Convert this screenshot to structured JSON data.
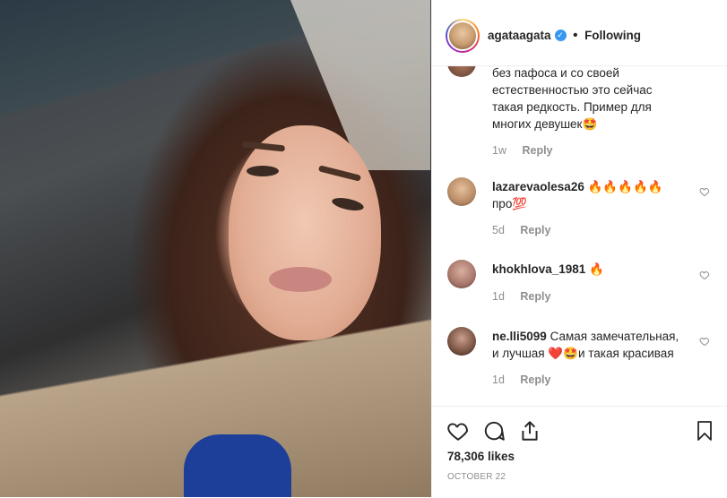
{
  "post": {
    "username": "agataagata",
    "separator": "•",
    "follow_status": "Following",
    "more_icon": "more-options-icon"
  },
  "comments": [
    {
      "text_line1": "без пафоса и со своей",
      "text_line2": "естественностью это сейчас",
      "text_line3": "такая редкость. Пример для",
      "text_line4": "многих девушек🤩",
      "time": "1w",
      "reply": "Reply"
    },
    {
      "username": "lazarevaolesa26",
      "text_line1": "🔥🔥🔥🔥🔥",
      "text_line2": "про💯",
      "time": "5d",
      "reply": "Reply"
    },
    {
      "username": "khokhlova_1981",
      "text_line1": "🔥",
      "time": "1d",
      "reply": "Reply"
    },
    {
      "username": "ne.lli5099",
      "text_line1": "Самая замечательная,",
      "text_line2": "и лучшая ❤️🤩и такая красивая",
      "time": "1d",
      "reply": "Reply"
    }
  ],
  "footer": {
    "likes": "78,306 likes",
    "date": "OCTOBER 22"
  },
  "colors": {
    "verified": "#3897f0",
    "muted": "#8e8e8e",
    "text": "#262626",
    "divider": "#efefef"
  }
}
